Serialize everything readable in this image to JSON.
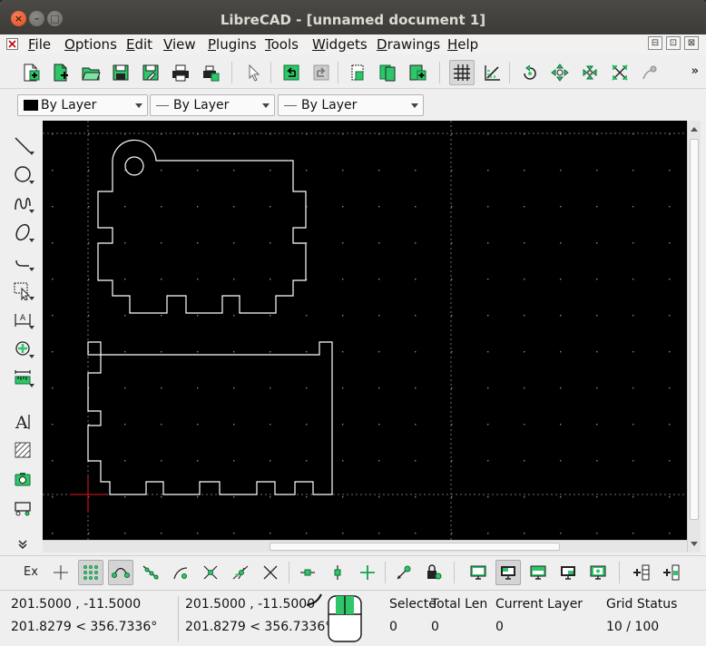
{
  "window": {
    "title": "LibreCAD - [unnamed document 1]",
    "close": "×",
    "minimize": "–",
    "maximize": "□"
  },
  "menu": [
    {
      "accel": "F",
      "rest": "ile"
    },
    {
      "accel": "O",
      "rest": "ptions"
    },
    {
      "accel": "E",
      "rest": "dit"
    },
    {
      "accel": "V",
      "rest": "iew"
    },
    {
      "accel": "P",
      "rest": "lugins"
    },
    {
      "accel": "T",
      "rest": "ools"
    },
    {
      "accel": "W",
      "rest": "idgets"
    },
    {
      "accel": "D",
      "rest": "rawings"
    },
    {
      "accel": "H",
      "rest": "elp"
    }
  ],
  "mdi": {
    "minimize": "⊟",
    "restore": "⊡",
    "close": "⊠"
  },
  "toolbar_overflow": "»",
  "pen": {
    "color": "By Layer",
    "width": "By Layer",
    "linetype": "By Layer"
  },
  "snap": {
    "exclusive_label": "Ex"
  },
  "status": {
    "abs_coord": "201.5000 , -11.5000",
    "abs_polar": "201.8279 < 356.7336°",
    "rel_coord": "201.5000 , -11.5000",
    "rel_polar": "201.8279 < 356.7336°",
    "selected_label": "Selecte",
    "selected_value": "0",
    "total_length_label": "Total Len",
    "total_length_value": "0",
    "current_layer_label": "Current Layer",
    "current_layer_value": "0",
    "grid_status_label": "Grid Status",
    "grid_status_value": "10 / 100"
  },
  "colors": {
    "accent_green": "#2fc66a",
    "canvas_bg": "#000000",
    "crosshair": "#c0141a",
    "drawing_stroke": "#ffffff"
  }
}
